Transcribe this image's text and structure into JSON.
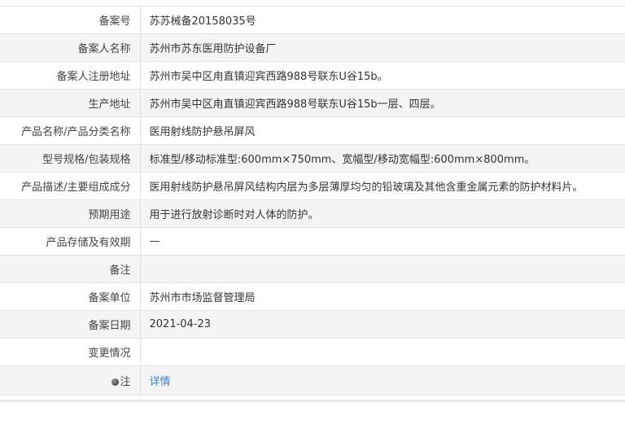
{
  "record_table": {
    "rows": [
      {
        "label": "备案号",
        "value": "苏苏械备20158035号"
      },
      {
        "label": "备案人名称",
        "value": "苏州市苏东医用防护设备厂"
      },
      {
        "label": "备案人注册地址",
        "value": "苏州市吴中区甪直镇迎宾西路988号联东U谷15b。"
      },
      {
        "label": "生产地址",
        "value": "苏州市吴中区甪直镇迎宾西路988号联东U谷15b一层、四层。"
      },
      {
        "label": "产品名称/产品分类名称",
        "value": "医用射线防护悬吊屏风"
      },
      {
        "label": "型号规格/包装规格",
        "value": "标准型/移动标准型:600mm×750mm、宽幅型/移动宽幅型:600mm×800mm。"
      },
      {
        "label": "产品描述/主要组成成分",
        "value": "医用射线防护悬吊屏风结构内层为多层薄厚均匀的铅玻璃及其他含重金属元素的防护材料片。"
      },
      {
        "label": "预期用途",
        "value": "用于进行放射诊断时对人体的防护。"
      },
      {
        "label": "产品存储及有效期",
        "value": "—"
      },
      {
        "label": "备注",
        "value": ""
      },
      {
        "label": "备案单位",
        "value": "苏州市市场监督管理局"
      },
      {
        "label": "备案日期",
        "value": "2021-04-23"
      },
      {
        "label": "变更情况",
        "value": ""
      }
    ],
    "note_row": {
      "icon": "pin-icon",
      "label": "注",
      "link_text": "详情"
    }
  },
  "colors": {
    "label_text": "#444444",
    "value_text": "#333333",
    "link": "#3a7fd5",
    "row_alt_bg": "#f4f4f4",
    "border": "#e2e2e2"
  }
}
